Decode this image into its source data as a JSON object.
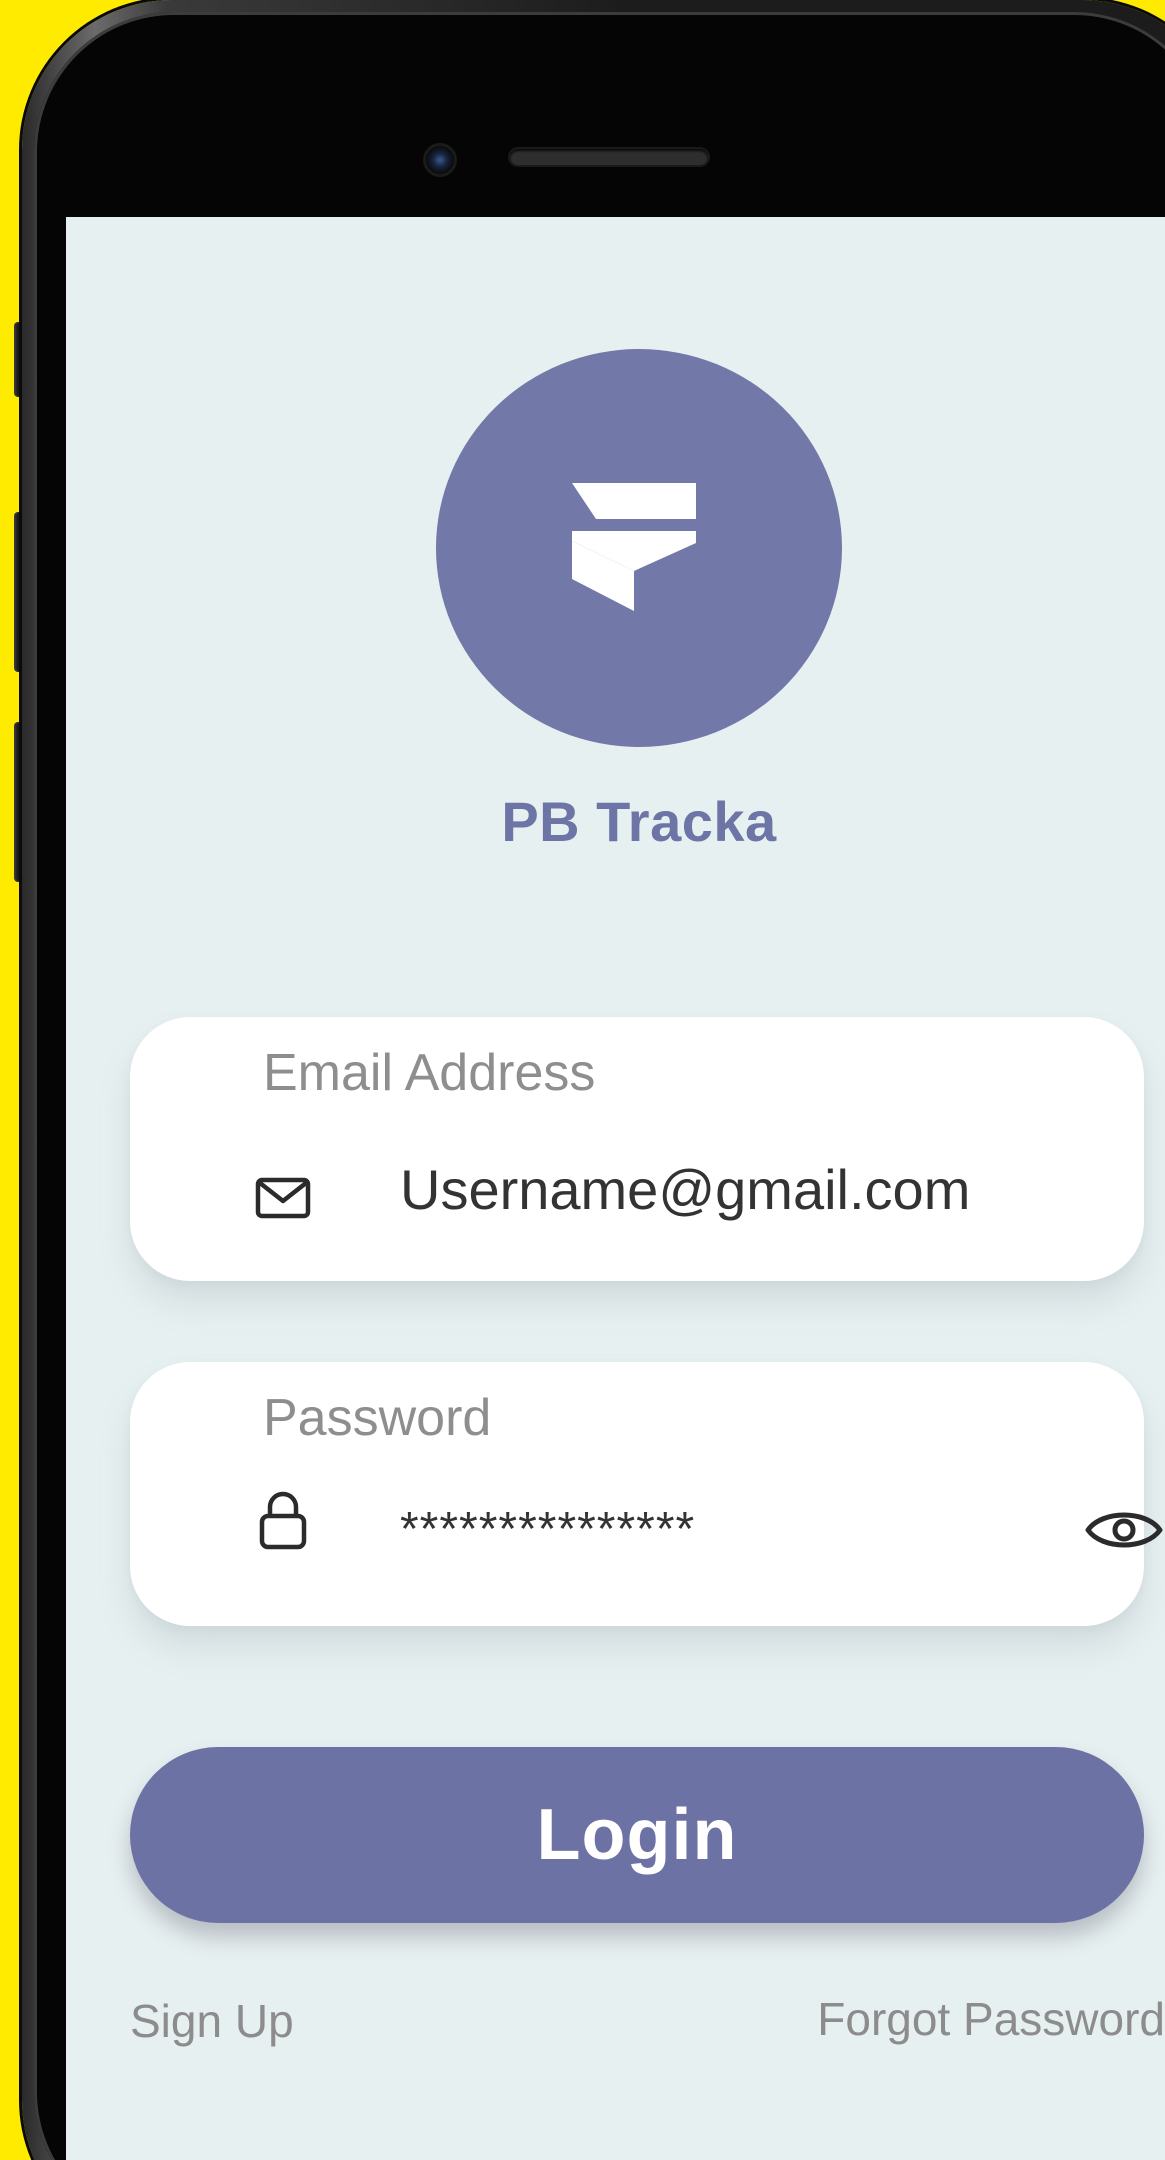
{
  "app": {
    "name": "PB Tracka",
    "brand_color": "#7278A8",
    "logo_icon": "flutterflow-logo-icon"
  },
  "form": {
    "email": {
      "label": "Email Address",
      "value": "Username@gmail.com",
      "icon": "mail-icon"
    },
    "password": {
      "label": "Password",
      "value": "***************",
      "icon": "lock-icon",
      "toggle_icon": "eye-icon"
    },
    "login_label": "Login"
  },
  "links": {
    "sign_up": "Sign Up",
    "forgot_password": "Forgot Password"
  },
  "colors": {
    "background": "#FFEB00",
    "screen": "#E7F0F1",
    "button": "#6D72A5",
    "muted_text": "#8C8C8C"
  }
}
